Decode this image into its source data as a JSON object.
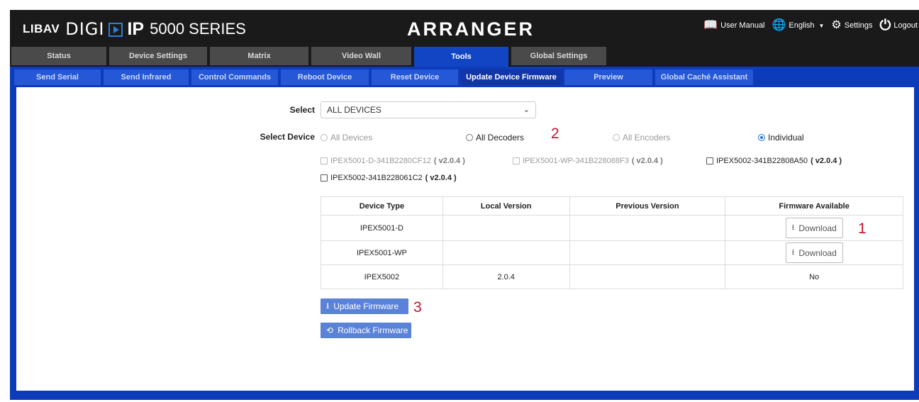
{
  "header": {
    "brand_libav": "LIBAV",
    "brand_digi": "DIGI",
    "brand_ip": "IP",
    "brand_series": "5000 SERIES",
    "title": "ARRANGER",
    "links": {
      "manual": "User Manual",
      "language": "English",
      "settings": "Settings",
      "logout": "Logout"
    }
  },
  "tabs": [
    {
      "label": "Status"
    },
    {
      "label": "Device Settings"
    },
    {
      "label": "Matrix"
    },
    {
      "label": "Video Wall"
    },
    {
      "label": "Tools"
    },
    {
      "label": "Global Settings"
    }
  ],
  "subtabs": [
    {
      "label": "Send Serial"
    },
    {
      "label": "Send Infrared"
    },
    {
      "label": "Control Commands"
    },
    {
      "label": "Reboot Device"
    },
    {
      "label": "Reset Device"
    },
    {
      "label": "Update Device Firmware"
    },
    {
      "label": "Preview"
    },
    {
      "label": "Global Caché Assistant"
    }
  ],
  "form": {
    "select_label": "Select",
    "select_value": "ALL DEVICES",
    "select_device_label": "Select Device",
    "radios": [
      {
        "label": "All Devices",
        "selected": false,
        "disabled": true
      },
      {
        "label": "All Decoders",
        "selected": false,
        "disabled": false
      },
      {
        "label": "All Encoders",
        "selected": false,
        "disabled": true
      },
      {
        "label": "Individual",
        "selected": true,
        "disabled": false
      }
    ],
    "devices": [
      {
        "name": "IPEX5001-D-341B2280CF12",
        "version": "( v2.0.4 )",
        "disabled": true
      },
      {
        "name": "IPEX5001-WP-341B228088F3",
        "version": "( v2.0.4 )",
        "disabled": true
      },
      {
        "name": "IPEX5002-341B22808A50",
        "version": "( v2.0.4 )",
        "disabled": false
      },
      {
        "name": "IPEX5002-341B228061C2",
        "version": "( v2.0.4 )",
        "disabled": false
      }
    ]
  },
  "table": {
    "headers": [
      "Device Type",
      "Local Version",
      "Previous Version",
      "Firmware Available"
    ],
    "rows": [
      {
        "type": "IPEX5001-D",
        "local": "",
        "previous": "",
        "available": "Download"
      },
      {
        "type": "IPEX5001-WP",
        "local": "",
        "previous": "",
        "available": "Download"
      },
      {
        "type": "IPEX5002",
        "local": "2.0.4",
        "previous": "",
        "available": "No"
      }
    ]
  },
  "buttons": {
    "update": "Update Firmware",
    "rollback": "Rollback Firmware"
  },
  "markers": {
    "m1": "1",
    "m2": "2",
    "m3": "3"
  },
  "colors": {
    "header_bg": "#1a1a1a",
    "active_tab": "#1245c4",
    "subbar": "#0c3cb9",
    "button_blue": "#5a82d8",
    "marker_red": "#c8102e"
  }
}
